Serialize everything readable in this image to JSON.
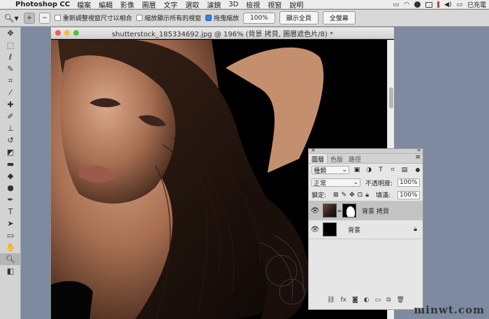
{
  "menubar": {
    "apple": "",
    "app": "Photoshop CC",
    "items": [
      "檔案",
      "編輯",
      "影像",
      "圖層",
      "文字",
      "選取",
      "濾鏡",
      "3D",
      "檢視",
      "視窗",
      "說明"
    ],
    "status": "已充電"
  },
  "options": {
    "tool_icon": "zoom-icon",
    "zoom_in": "+",
    "zoom_out": "−",
    "resize_windows": "重新調整視窗尺寸以相合",
    "zoom_all_windows": "縮放顯示所有的視窗",
    "scrubby_zoom": "拖曳縮放",
    "zoom_value": "100%",
    "fit_screen": "顯示全頁",
    "fill_screen": "全螢幕"
  },
  "document": {
    "title": "shutterstock_185334692.jpg @ 196% (背景 拷貝, 圖層遮色片/8) *",
    "traffic_colors": [
      "#f35c55",
      "#f6bd3b",
      "#4dc644"
    ]
  },
  "layers_panel": {
    "tabs": [
      "圖層",
      "色版",
      "路徑"
    ],
    "filter_label": "種類",
    "blend_mode": "正常",
    "opacity_label": "不透明度:",
    "opacity_value": "100%",
    "lock_label": "鎖定:",
    "fill_label": "填滿:",
    "fill_value": "100%",
    "layers": [
      {
        "name": "背景 拷貝",
        "visible": true,
        "selected": true
      },
      {
        "name": "背景",
        "visible": true,
        "locked": true
      }
    ],
    "footer_icons": [
      "link-icon",
      "fx-icon",
      "mask-icon",
      "adjustment-icon",
      "folder-icon",
      "new-layer-icon",
      "trash-icon"
    ],
    "fx_label": "fx"
  },
  "watermark": "minwt.com"
}
